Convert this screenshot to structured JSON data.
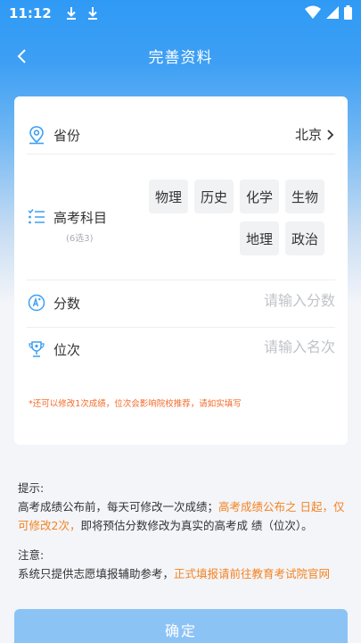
{
  "status_bar": {
    "time": "11:12"
  },
  "header": {
    "title": "完善资料"
  },
  "form": {
    "province_label": "省份",
    "province_value": "北京",
    "subject_label": "高考科目",
    "subject_hint": "(6选3)",
    "subjects": [
      "物理",
      "历史",
      "化学",
      "生物",
      "地理",
      "政治"
    ],
    "score_label": "分数",
    "score_placeholder": "请输入分数",
    "rank_label": "位次",
    "rank_placeholder": "请输入名次",
    "warning": "*还可以修改1次成绩，位次会影响院校推荐，请如实填写"
  },
  "tips": {
    "title": "提示:",
    "line1_normal": "高考成绩公布前，每天可修改一次成绩；",
    "line1_orange": "高考成绩公布之 日起，仅可修改2次，",
    "line1_tail": "即将预估分数修改为真实的高考成 绩（位次）。",
    "notice_title": "注意:",
    "notice_normal": "系统只提供志愿填报辅助参考，",
    "notice_orange": "正式填报请前往教育考试院官网"
  },
  "confirm_label": "确定",
  "colors": {
    "primary": "#3d9ff4",
    "button": "#8cc3f5",
    "warning": "#f26b2a",
    "highlight": "#f5821f"
  },
  "icons": [
    "download-icon",
    "wifi-icon",
    "signal-icon",
    "battery-icon",
    "back-arrow-icon",
    "location-icon",
    "list-icon",
    "score-icon",
    "trophy-icon",
    "chevron-right-icon"
  ]
}
